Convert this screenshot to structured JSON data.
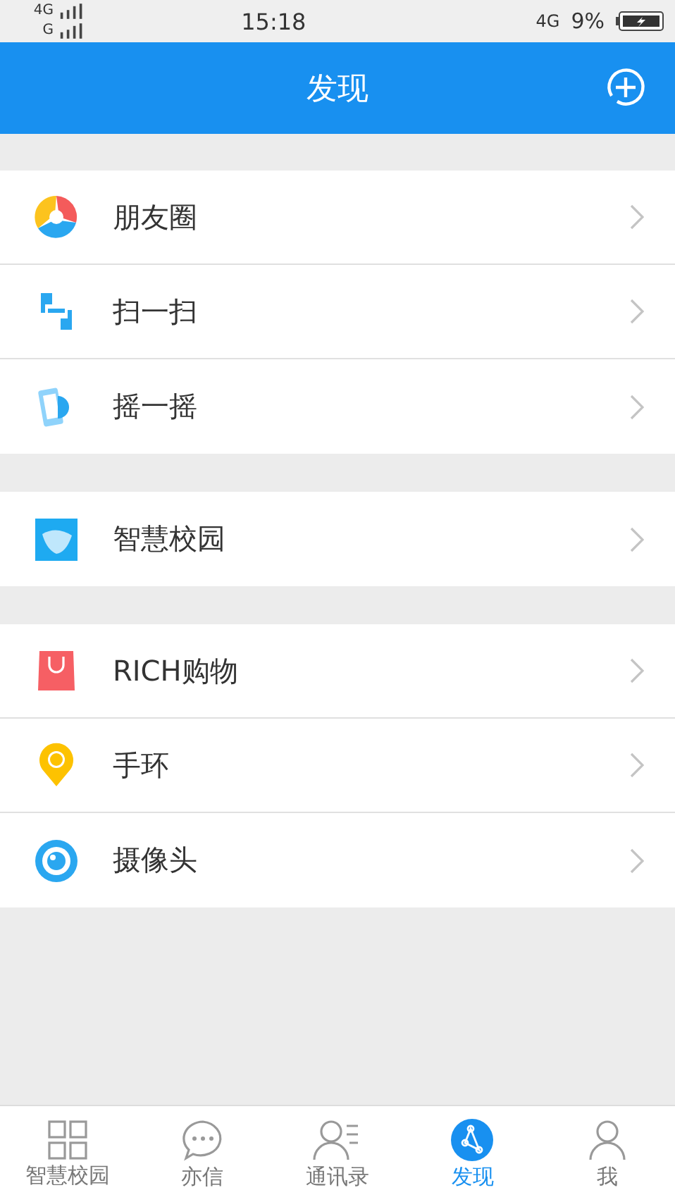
{
  "status_bar": {
    "sim1": "4G",
    "sim2": "G",
    "time": "15:18",
    "network": "4G",
    "battery": "9%"
  },
  "header": {
    "title": "发现"
  },
  "groups": [
    {
      "items": [
        {
          "label": "朋友圈",
          "kind": "moments"
        },
        {
          "label": "扫一扫",
          "kind": "scan"
        },
        {
          "label": "摇一摇",
          "kind": "shake"
        }
      ]
    },
    {
      "items": [
        {
          "label": "智慧校园",
          "kind": "campus"
        }
      ]
    },
    {
      "items": [
        {
          "label": "RICH购物",
          "kind": "shop"
        },
        {
          "label": "手环",
          "kind": "band"
        },
        {
          "label": "摄像头",
          "kind": "camera"
        }
      ]
    }
  ],
  "tabs": [
    {
      "label": "智慧校园",
      "kind": "grid",
      "selected": false
    },
    {
      "label": "亦信",
      "kind": "chat",
      "selected": false
    },
    {
      "label": "通讯录",
      "kind": "contacts",
      "selected": false
    },
    {
      "label": "发现",
      "kind": "discover",
      "selected": true
    },
    {
      "label": "我",
      "kind": "me",
      "selected": false
    }
  ]
}
